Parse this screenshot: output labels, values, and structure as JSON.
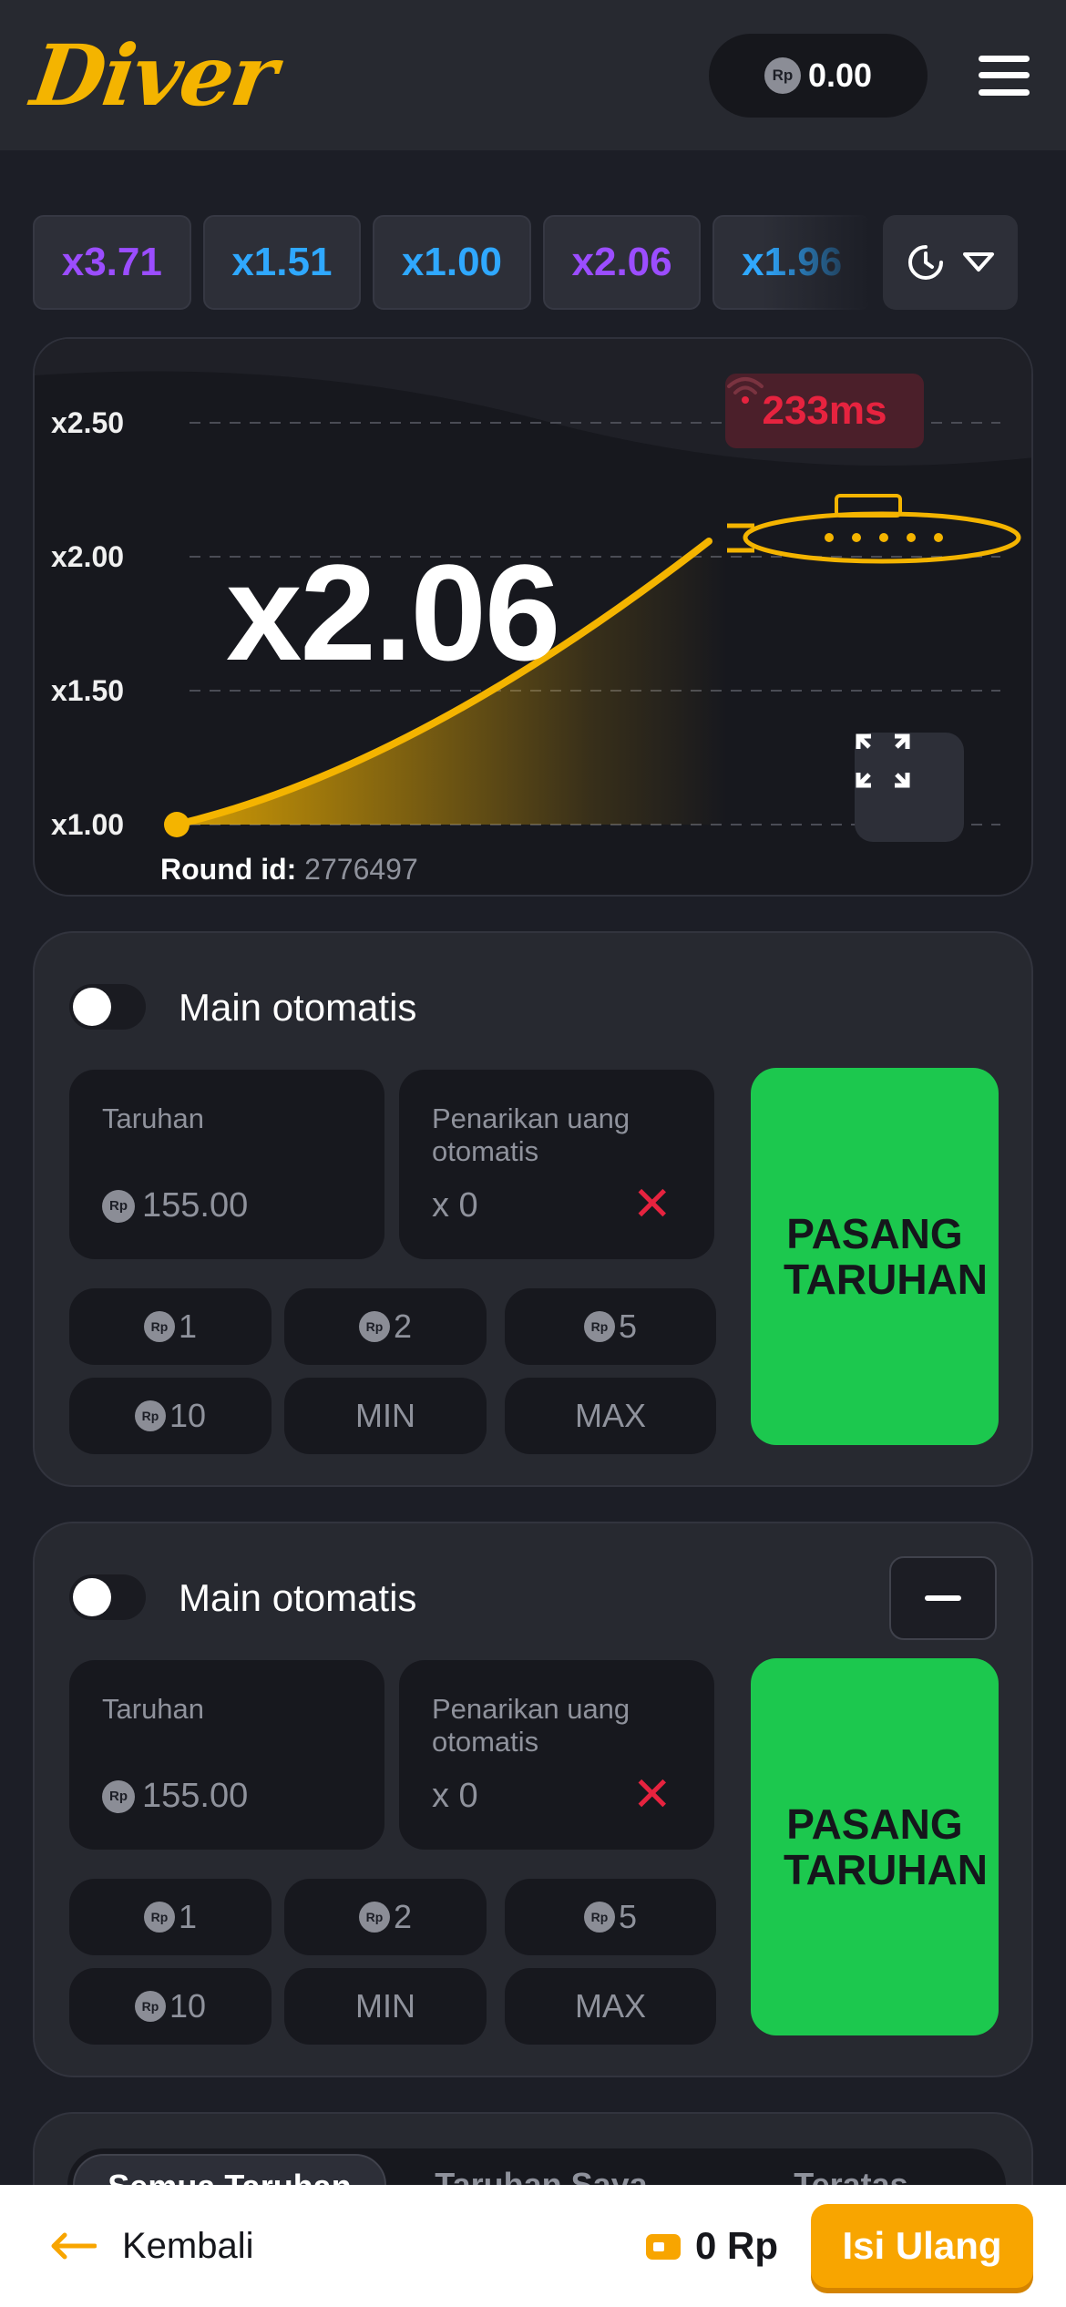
{
  "header": {
    "logo_text": "Diver",
    "currency_badge": "Rp",
    "balance": "0.00"
  },
  "history": {
    "multipliers": [
      {
        "label": "x3.71",
        "color": "#9b4dff"
      },
      {
        "label": "x1.51",
        "color": "#2fa8ff"
      },
      {
        "label": "x1.00",
        "color": "#2fa8ff"
      },
      {
        "label": "x2.06",
        "color": "#9b4dff"
      },
      {
        "label": "x1.96",
        "color": "#2fa8ff"
      }
    ],
    "history_icon": "clock-icon",
    "dropdown_icon": "chevron-down-icon"
  },
  "game": {
    "y_ticks": [
      "x2.50",
      "x2.00",
      "x1.50",
      "x1.00"
    ],
    "current_multiplier": "x2.06",
    "ping": "233ms",
    "round_label": "Round id:",
    "round_id": "2776497",
    "accent_color": "#f4b400"
  },
  "panels": [
    {
      "auto_label": "Main otomatis",
      "bet_label": "Taruhan",
      "currency_badge": "Rp",
      "bet_value": "155.00",
      "cashout_label": "Penarikan uang otomatis",
      "cashout_value": "x 0",
      "quick_amounts": [
        "1",
        "2",
        "5",
        "10"
      ],
      "min_label": "MIN",
      "max_label": "MAX",
      "place_bet_label": "PASANG TARUHAN"
    },
    {
      "auto_label": "Main otomatis",
      "bet_label": "Taruhan",
      "currency_badge": "Rp",
      "bet_value": "155.00",
      "cashout_label": "Penarikan uang otomatis",
      "cashout_value": "x 0",
      "quick_amounts": [
        "1",
        "2",
        "5",
        "10"
      ],
      "min_label": "MIN",
      "max_label": "MAX",
      "place_bet_label": "PASANG TARUHAN"
    }
  ],
  "bets_tabs": [
    "Semua Taruhan",
    "Taruhan Saya",
    "Teratas"
  ],
  "bottom_bar": {
    "back_label": "Kembali",
    "wallet_amount": "0 Rp",
    "refill_label": "Isi Ulang"
  }
}
